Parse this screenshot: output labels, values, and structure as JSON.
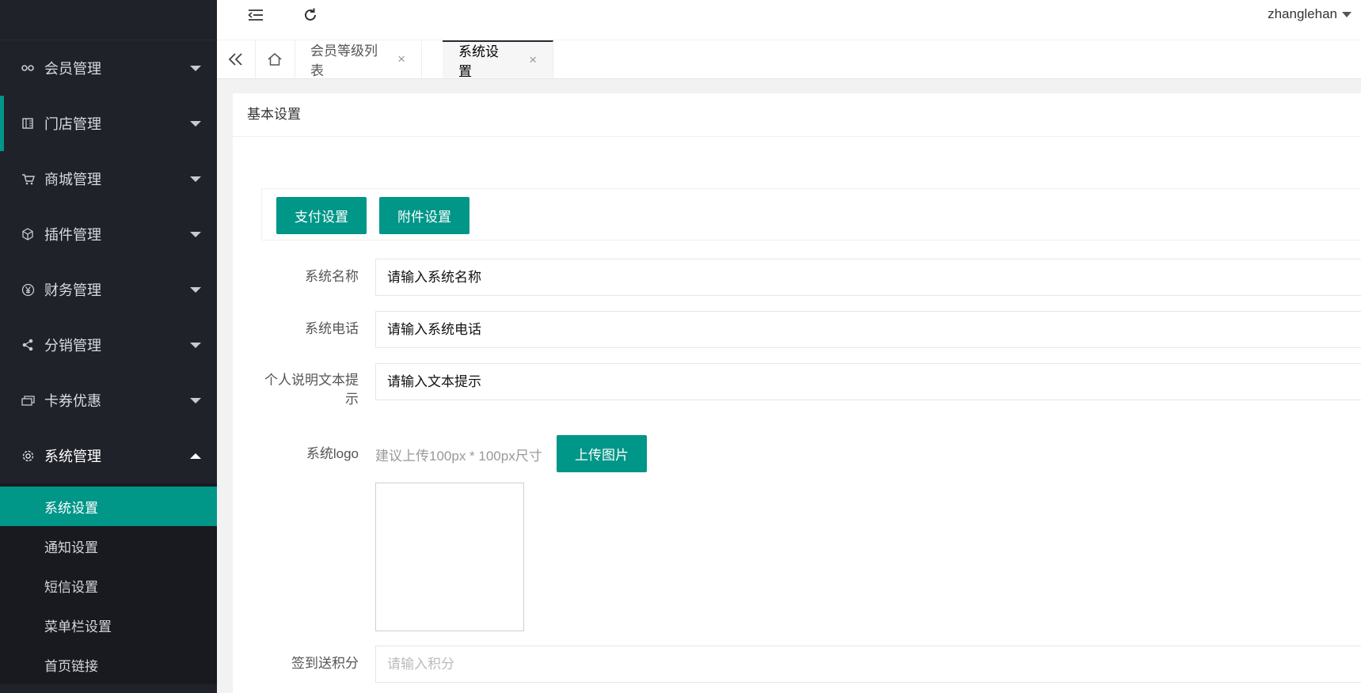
{
  "header": {
    "user_name": "zhanglehan",
    "icons": {
      "collapse": "menu-fold-icon",
      "refresh": "refresh-icon"
    }
  },
  "sidebar": {
    "items": [
      {
        "label": "会员管理",
        "icon": "members-icon"
      },
      {
        "label": "门店管理",
        "icon": "store-icon"
      },
      {
        "label": "商城管理",
        "icon": "cart-icon"
      },
      {
        "label": "插件管理",
        "icon": "cube-icon"
      },
      {
        "label": "财务管理",
        "icon": "yen-icon"
      },
      {
        "label": "分销管理",
        "icon": "share-icon"
      },
      {
        "label": "卡券优惠",
        "icon": "coupon-icon"
      },
      {
        "label": "系统管理",
        "icon": "gear-icon"
      }
    ],
    "submenu": [
      {
        "label": "系统设置",
        "selected": true
      },
      {
        "label": "通知设置"
      },
      {
        "label": "短信设置"
      },
      {
        "label": "菜单栏设置"
      },
      {
        "label": "首页链接"
      }
    ],
    "accent_color": "#009688"
  },
  "tabs": {
    "items": [
      {
        "label": "会员等级列表",
        "close": "×"
      },
      {
        "label": "系统设置",
        "close": "×"
      }
    ]
  },
  "main": {
    "card_title": "基本设置",
    "buttons": {
      "pay_settings": "支付设置",
      "attachment_settings": "附件设置",
      "upload_image": "上传图片"
    },
    "form": {
      "system_name": {
        "label": "系统名称",
        "placeholder": "请输入系统名称"
      },
      "system_phone": {
        "label": "系统电话",
        "placeholder": "请输入系统电话"
      },
      "personal_text": {
        "label": "个人说明文本提示",
        "placeholder": "请输入文本提示"
      },
      "system_logo": {
        "label": "系统logo",
        "hint": "建议上传100px * 100px尺寸"
      },
      "sign_points": {
        "label": "签到送积分",
        "placeholder": "请输入积分"
      }
    }
  }
}
